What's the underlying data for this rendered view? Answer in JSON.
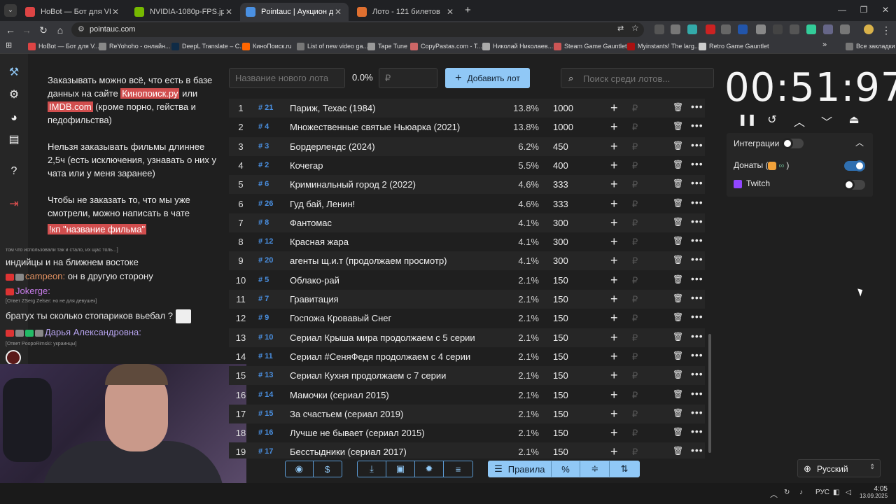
{
  "browser": {
    "tabs": [
      {
        "title": "HoBot — Бот для VK Video Live",
        "color": "#d44"
      },
      {
        "title": "NVIDIA-1080p-FPS.jpg (3840×2160)",
        "color": "#76b900"
      },
      {
        "title": "Pointauc | Аукцион для стримеров",
        "color": "#4a90e2"
      },
      {
        "title": "Лото - 121 билетов",
        "color": "#e07030"
      }
    ],
    "url": "pointauc.com",
    "bookmarks": [
      {
        "label": "HoBot — Бот для V...",
        "color": "#d44"
      },
      {
        "label": "ReYohoho - онлайн...",
        "color": "#888"
      },
      {
        "label": "DeepL Translate – C...",
        "color": "#0f2b46"
      },
      {
        "label": "КиноПоиск.ru",
        "color": "#f60"
      },
      {
        "label": "List of new video ga...",
        "color": "#777"
      },
      {
        "label": "Tape Tune",
        "color": "#999"
      },
      {
        "label": "CopyPastas.com - T...",
        "color": "#c66"
      },
      {
        "label": "Николай Николаев...",
        "color": "#aaa"
      },
      {
        "label": "Steam Game Gauntlet",
        "color": "#c55"
      },
      {
        "label": "Myinstants! The larg...",
        "color": "#a11"
      },
      {
        "label": "Retro Game Gauntlet",
        "color": "#ccc"
      }
    ],
    "all_bookmarks": "Все закладки"
  },
  "rules": {
    "p1_a": "Заказывать можно всё, что есть в базе данных на сайте ",
    "p1_link1": "Кинопоиск.ру",
    "p1_b": " или ",
    "p1_link2": "IMDB.com",
    "p1_c": " (кроме порно, гейства и педофильства)",
    "p2": "Нельзя заказывать фильмы длиннее 2,5ч (есть исключения, узнавать о них у чата или у меня заранее)",
    "p3": "Чтобы не заказать то, что мы уже смотрели, можно написать в чате",
    "p3_cmd": "!кп \"название фильма\""
  },
  "chat": {
    "l0": "том что использовали так и стало, их щас толь...]",
    "l1": "индийцы и на ближнем востоке",
    "l2_user": "campeon:",
    "l2_msg": " он в другую сторону",
    "l3_user": "Jokerge:",
    "l4": "[Ответ ZSerg Zelser: но не для девушек]",
    "l5": "братух ты сколько стопариков вьебал ?",
    "l6_user": "Дарья Александровна:",
    "l7": "[Ответ PoopoRimski: украинцы]"
  },
  "lot_input": {
    "name_placeholder": "Название нового лота",
    "percent": "0.0%",
    "amount_placeholder": "₽",
    "add_label": "Добавить лот",
    "search_placeholder": "Поиск среди лотов..."
  },
  "lots": [
    {
      "n": "1",
      "id": "# 21",
      "name": "Париж, Техас (1984)",
      "pct": "13.8%",
      "amount": "1000"
    },
    {
      "n": "2",
      "id": "# 4",
      "name": "Множественные святые Ньюарка (2021)",
      "pct": "13.8%",
      "amount": "1000"
    },
    {
      "n": "3",
      "id": "# 3",
      "name": "Бордерлендс (2024)",
      "pct": "6.2%",
      "amount": "450"
    },
    {
      "n": "4",
      "id": "# 2",
      "name": "Кочегар",
      "pct": "5.5%",
      "amount": "400"
    },
    {
      "n": "5",
      "id": "# 6",
      "name": "Криминальный город 2 (2022)",
      "pct": "4.6%",
      "amount": "333"
    },
    {
      "n": "6",
      "id": "# 26",
      "name": "Гуд бай, Ленин!",
      "pct": "4.6%",
      "amount": "333"
    },
    {
      "n": "7",
      "id": "# 8",
      "name": "Фантомас",
      "pct": "4.1%",
      "amount": "300"
    },
    {
      "n": "8",
      "id": "# 12",
      "name": "Красная жара",
      "pct": "4.1%",
      "amount": "300"
    },
    {
      "n": "9",
      "id": "# 20",
      "name": "агенты щ.и.т (продолжаем просмотр)",
      "pct": "4.1%",
      "amount": "300"
    },
    {
      "n": "10",
      "id": "# 5",
      "name": "Облако-рай",
      "pct": "2.1%",
      "amount": "150"
    },
    {
      "n": "11",
      "id": "# 7",
      "name": "Гравитация",
      "pct": "2.1%",
      "amount": "150"
    },
    {
      "n": "12",
      "id": "# 9",
      "name": "Госпожа Кровавый Снег",
      "pct": "2.1%",
      "amount": "150"
    },
    {
      "n": "13",
      "id": "# 10",
      "name": "Сериал Крыша мира продолжаем с 5 серии",
      "pct": "2.1%",
      "amount": "150"
    },
    {
      "n": "14",
      "id": "# 11",
      "name": "Сериал #СеняФедя продолжаем с 4 серии",
      "pct": "2.1%",
      "amount": "150"
    },
    {
      "n": "15",
      "id": "# 13",
      "name": "Сериал Кухня продолжаем с 7 серии",
      "pct": "2.1%",
      "amount": "150"
    },
    {
      "n": "16",
      "id": "# 14",
      "name": "Мамочки (сериал 2015)",
      "pct": "2.1%",
      "amount": "150"
    },
    {
      "n": "17",
      "id": "# 15",
      "name": "За счастьем (сериал 2019)",
      "pct": "2.1%",
      "amount": "150"
    },
    {
      "n": "18",
      "id": "# 16",
      "name": "Лучше не бывает (сериал 2015)",
      "pct": "2.1%",
      "amount": "150"
    },
    {
      "n": "19",
      "id": "# 17",
      "name": "Бесстыдники (сериал 2017)",
      "pct": "2.1%",
      "amount": "150"
    }
  ],
  "bottom": {
    "rules_label": "Правила"
  },
  "timer": "00:51:97",
  "integrations": {
    "title": "Интеграции",
    "donations_label": "Донаты (",
    "donations_end": ")",
    "donations_on": true,
    "twitch_label": "Twitch",
    "twitch_on": false
  },
  "language": "Русский",
  "taskbar": {
    "lang": "РУС",
    "time": "4:05",
    "date": "13.09.2025"
  },
  "colors": {
    "accent": "#90c8f6",
    "id_blue": "#4a90e2",
    "highlight": "#d14e4e"
  }
}
